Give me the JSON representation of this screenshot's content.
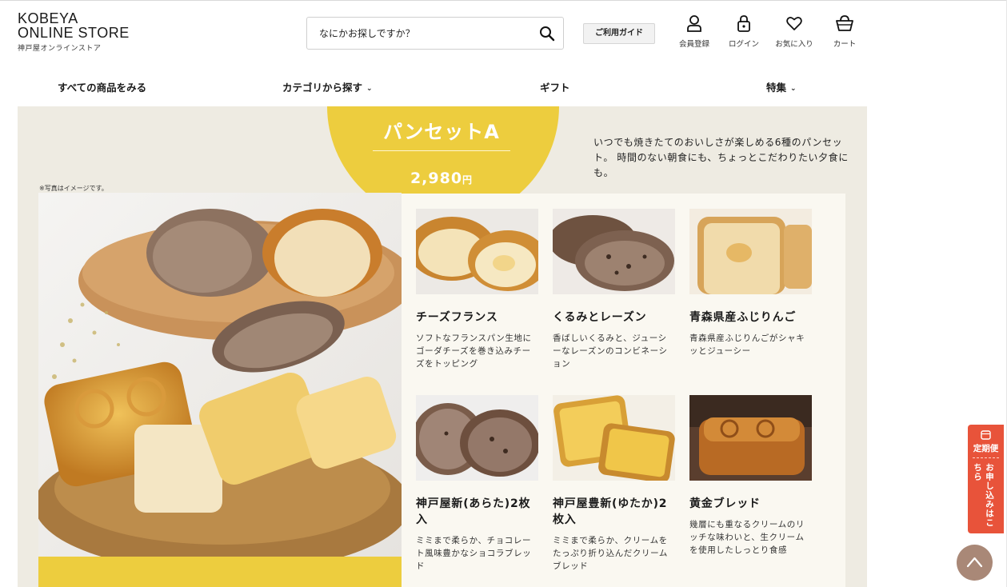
{
  "header": {
    "logo_line1": "KOBEYA",
    "logo_line2": "ONLINE STORE",
    "logo_sub": "神戸屋オンラインストア",
    "search_placeholder": "なにかお探しですか？",
    "guide_label": "ご利用ガイド",
    "icons": [
      {
        "name": "user-icon",
        "label": "会員登録"
      },
      {
        "name": "lock-icon",
        "label": "ログイン"
      },
      {
        "name": "heart-icon",
        "label": "お気に入り"
      },
      {
        "name": "cart-icon",
        "label": "カート"
      }
    ]
  },
  "nav": {
    "all": "すべての商品をみる",
    "category": "カテゴリから探す",
    "gift": "ギフト",
    "feature": "特集"
  },
  "hero": {
    "title": "パンセットA",
    "price": "2,980",
    "yen": "円",
    "description": "いつでも焼きたてのおいしさが楽しめる6種のパンセット。 時間のない朝食にも、ちょっとこだわりたい夕食にも。",
    "note": "※写真はイメージです。",
    "accent_color": "#edcd3e"
  },
  "products": [
    {
      "name": "チーズフランス",
      "desc": "ソフトなフランスパン生地にゴーダチーズを巻き込みチーズをトッピング"
    },
    {
      "name": "くるみとレーズン",
      "desc": "香ばしいくるみと、ジューシーなレーズンのコンビネーション"
    },
    {
      "name": "青森県産ふじりんご",
      "desc": "青森県産ふじりんごがシャキッとジューシー"
    },
    {
      "name": "神戸屋新(あらた)2枚入",
      "desc": "ミミまで柔らか、チョコレート風味豊かなショコラブレッド"
    },
    {
      "name": "神戸屋豊新(ゆたか)2枚入",
      "desc": "ミミまで柔らか、クリームをたっぷり折り込んだクリームブレッド"
    },
    {
      "name": "黄金ブレッド",
      "desc": "幾層にも重なるクリームのリッチな味わいと、生クリームを使用したしっとり食感"
    }
  ],
  "floating": {
    "subscription_title": "定期便",
    "subscription_cta": "お申し込みはこちら"
  }
}
